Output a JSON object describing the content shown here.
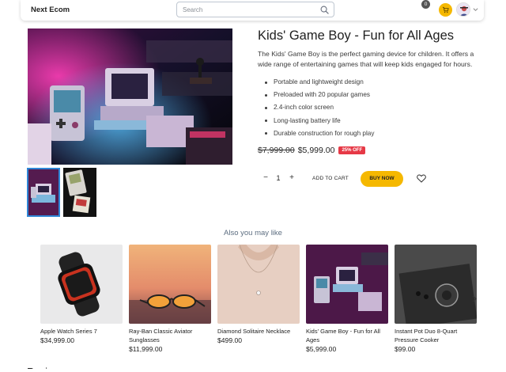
{
  "header": {
    "brand": "Next Ecom",
    "search_placeholder": "Search",
    "cart_count": "0",
    "accent_color": "#f5b800"
  },
  "product": {
    "title": "Kids' Game Boy - Fun for All Ages",
    "description": "The Kids' Game Boy is the perfect gaming device for children. It offers a wide range of entertaining games that will keep kids engaged for hours.",
    "features": [
      "Portable and lightweight design",
      "Preloaded with 20 popular games",
      "2.4-inch color screen",
      "Long-lasting battery life",
      "Durable construction for rough play"
    ],
    "old_price": "$7,999.00",
    "price": "$5,999.00",
    "discount_badge": "25% OFF",
    "quantity": "1",
    "minus_label": "−",
    "plus_label": "+",
    "add_to_cart_label": "ADD TO CART",
    "buy_now_label": "BUY NOW",
    "discount_color": "#e63946"
  },
  "related": {
    "heading": "Also you may like",
    "items": [
      {
        "name": "Apple Watch Series 7",
        "price": "$34,999.00"
      },
      {
        "name": "Ray-Ban Classic Aviator Sunglasses",
        "price": "$11,999.00"
      },
      {
        "name": "Diamond Solitaire Necklace",
        "price": "$499.00"
      },
      {
        "name": "Kids' Game Boy - Fun for All Ages",
        "price": "$5,999.00"
      },
      {
        "name": "Instant Pot Duo 8-Quart Pressure Cooker",
        "price": "$99.00"
      }
    ]
  },
  "reviews_heading": "Reviews"
}
